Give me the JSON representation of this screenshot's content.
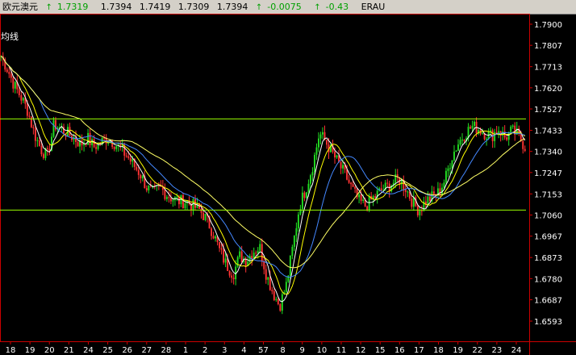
{
  "header": {
    "title": "欧元澳元",
    "last_price": "1.7319",
    "open": "1.7394",
    "high": "1.7419",
    "low": "1.7309",
    "close": "1.7394",
    "change": "-0.0075",
    "change_pct": "-0.43",
    "symbol": "ERAU",
    "arrow_symbol": "↑"
  },
  "indicator_label": "均线",
  "colors": {
    "background": "#000000",
    "frame": "#cc0000",
    "candle_up": "#22dd22",
    "candle_down": "#ff3333",
    "ma_short": "#ffffff",
    "ma_mid": "#ffff00",
    "ma_long": "#4488ff",
    "ma_longest": "#ffff66",
    "trendline": "#99ff00",
    "axis_text": "#ffffff"
  },
  "chart_data": {
    "type": "candlestick",
    "y_ticks": [
      "1.7900",
      "1.7807",
      "1.7713",
      "1.7620",
      "1.7527",
      "1.7433",
      "1.7340",
      "1.7247",
      "1.7153",
      "1.7060",
      "1.6967",
      "1.6873",
      "1.6780",
      "1.6687",
      "1.6593"
    ],
    "x_ticks": [
      "18",
      "19",
      "20",
      "21",
      "24",
      "25",
      "26",
      "27",
      "28",
      "1",
      "2",
      "3",
      "4",
      "57",
      "8",
      "9",
      "10",
      "11",
      "12",
      "15",
      "16",
      "17",
      "18",
      "19",
      "22",
      "23",
      "24"
    ],
    "ylim": [
      1.6593,
      1.79
    ],
    "horizontal_lines": [
      1.7483,
      1.7082
    ],
    "close_path": [
      1.776,
      1.77,
      1.763,
      1.758,
      1.752,
      1.742,
      1.735,
      1.732,
      1.746,
      1.744,
      1.742,
      1.74,
      1.737,
      1.74,
      1.736,
      1.738,
      1.74,
      1.738,
      1.735,
      1.732,
      1.728,
      1.724,
      1.718,
      1.716,
      1.718,
      1.715,
      1.713,
      1.712,
      1.712,
      1.71,
      1.708,
      1.704,
      1.698,
      1.69,
      1.684,
      1.68,
      1.688,
      1.686,
      1.69,
      1.692,
      1.68,
      1.672,
      1.666,
      1.675,
      1.692,
      1.71,
      1.718,
      1.728,
      1.742,
      1.738,
      1.733,
      1.728,
      1.723,
      1.717,
      1.712,
      1.71,
      1.713,
      1.716,
      1.718,
      1.72,
      1.722,
      1.718,
      1.712,
      1.708,
      1.712,
      1.714,
      1.716,
      1.722,
      1.732,
      1.738,
      1.742,
      1.745,
      1.744,
      1.742,
      1.741,
      1.744,
      1.74,
      1.743,
      1.741,
      1.736
    ]
  }
}
